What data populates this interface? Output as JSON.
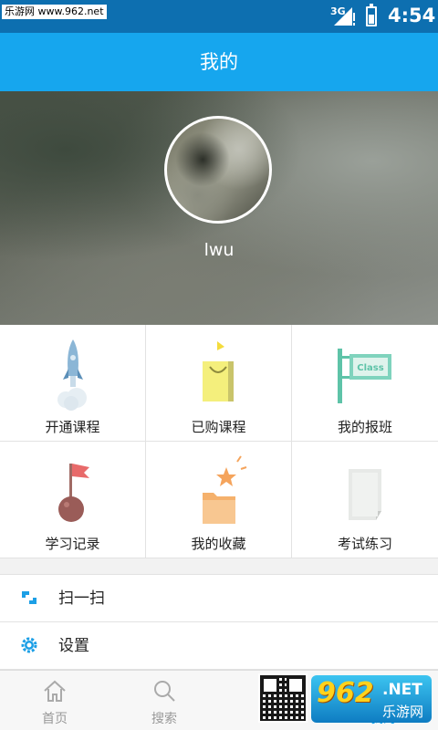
{
  "status_bar": {
    "watermark": "乐游网 www.962.net",
    "network": "3G",
    "time": "4:54"
  },
  "header": {
    "title": "我的"
  },
  "profile": {
    "username": "lwu"
  },
  "grid": [
    {
      "label": "开通课程",
      "icon": "rocket-icon"
    },
    {
      "label": "已购课程",
      "icon": "shopping-bag-icon"
    },
    {
      "label": "我的报班",
      "icon": "class-sign-icon",
      "sign_text": "Class"
    },
    {
      "label": "学习记录",
      "icon": "flag-ball-icon"
    },
    {
      "label": "我的收藏",
      "icon": "folder-star-icon"
    },
    {
      "label": "考试练习",
      "icon": "paper-icon"
    }
  ],
  "menu": [
    {
      "label": "扫一扫",
      "icon": "scan-icon"
    },
    {
      "label": "设置",
      "icon": "gear-icon"
    }
  ],
  "bottom_nav": [
    {
      "label": "首页",
      "icon": "home-icon",
      "active": false
    },
    {
      "label": "搜索",
      "icon": "search-icon",
      "active": false
    },
    {
      "label": "我的",
      "icon": "profile-icon",
      "active": true
    }
  ],
  "watermark": {
    "brand": "962",
    "tld": ".NET",
    "name": "乐游网"
  },
  "colors": {
    "primary": "#16a6ee",
    "status_bar": "#0d6fb0"
  }
}
